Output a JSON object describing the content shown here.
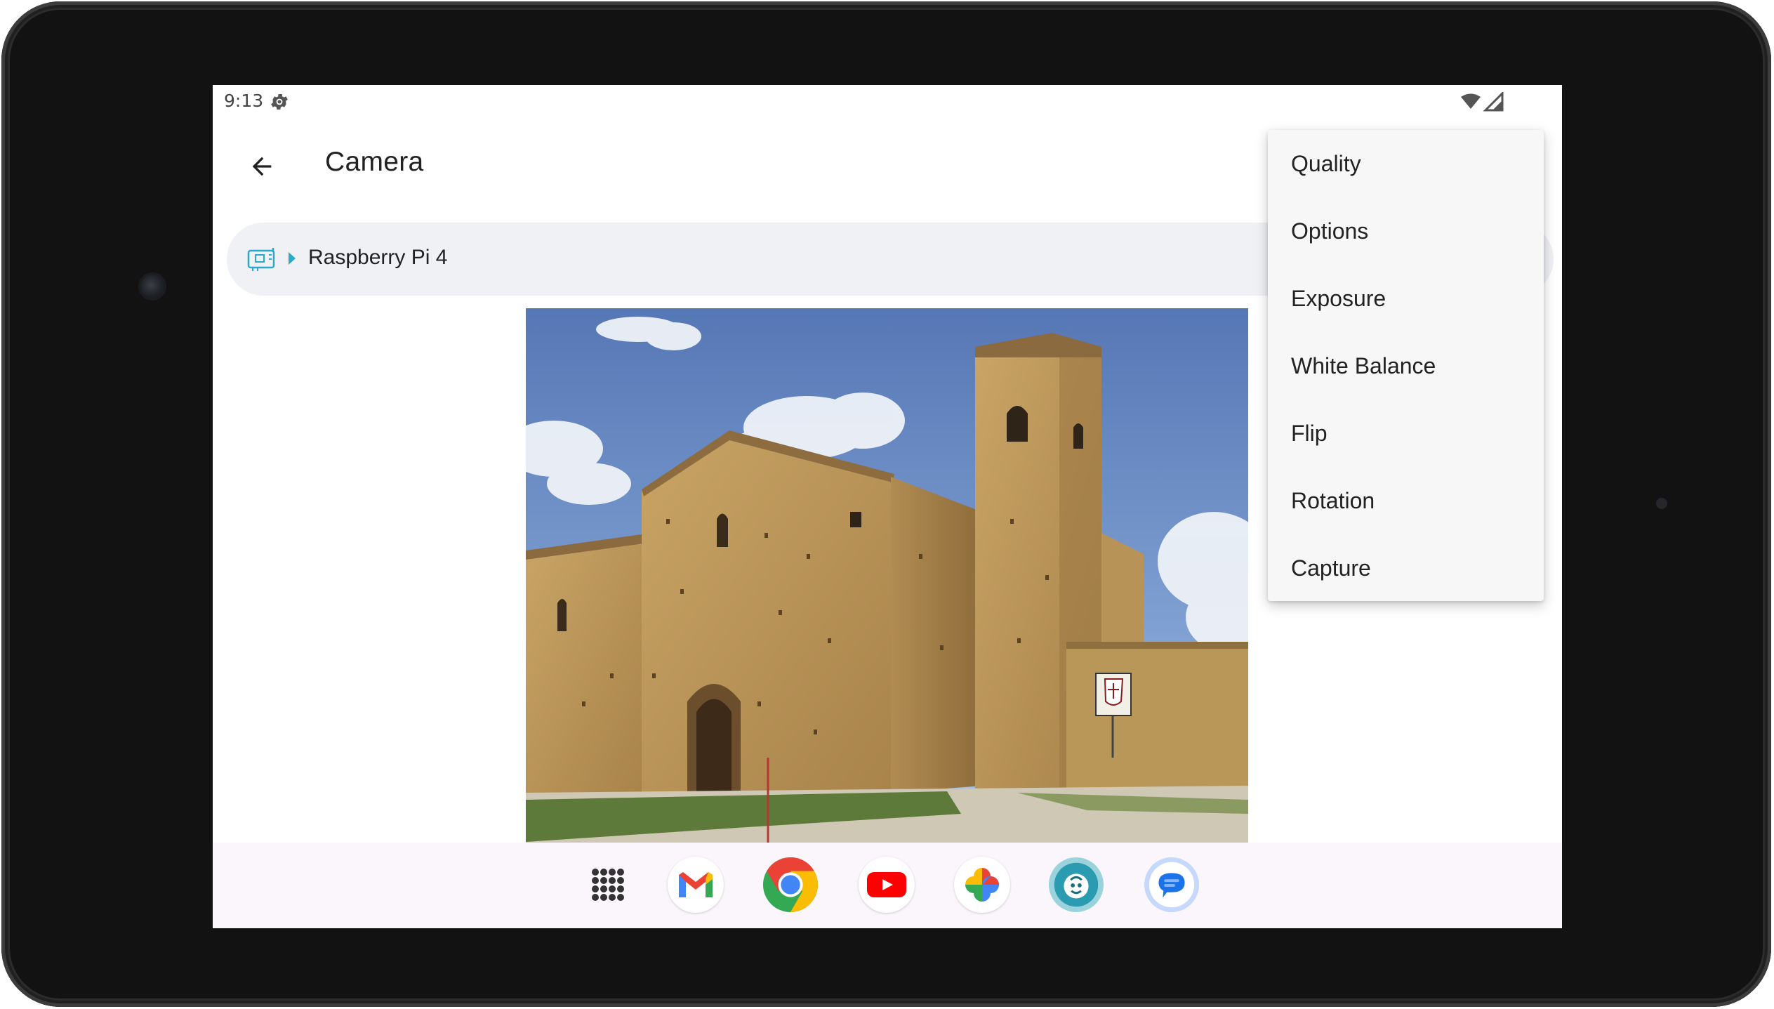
{
  "status_bar": {
    "time": "9:13",
    "settings_icon": "gear-icon",
    "wifi_icon": "wifi-icon",
    "signal_icon": "signal-icon"
  },
  "app_bar": {
    "title": "Camera",
    "back_icon": "arrow-back-icon"
  },
  "breadcrumb": {
    "device_icon": "board-icon",
    "caret_icon": "caret-right-icon",
    "label": "Raspberry Pi 4",
    "accent_color": "#2aa9c9"
  },
  "camera_view": {
    "icon": "camera-preview-image"
  },
  "menu": {
    "items": [
      {
        "label": "Quality"
      },
      {
        "label": "Options"
      },
      {
        "label": "Exposure"
      },
      {
        "label": "White Balance"
      },
      {
        "label": "Flip"
      },
      {
        "label": "Rotation"
      },
      {
        "label": "Capture"
      }
    ]
  },
  "taskbar": {
    "apps": [
      {
        "name": "app-drawer",
        "icon": "grid-dots-icon"
      },
      {
        "name": "gmail",
        "icon": "gmail-icon"
      },
      {
        "name": "chrome",
        "icon": "chrome-icon"
      },
      {
        "name": "youtube",
        "icon": "youtube-icon"
      },
      {
        "name": "photos",
        "icon": "photos-icon"
      },
      {
        "name": "custom-app",
        "icon": "custom-app-icon"
      },
      {
        "name": "messages",
        "icon": "messages-icon"
      }
    ]
  }
}
